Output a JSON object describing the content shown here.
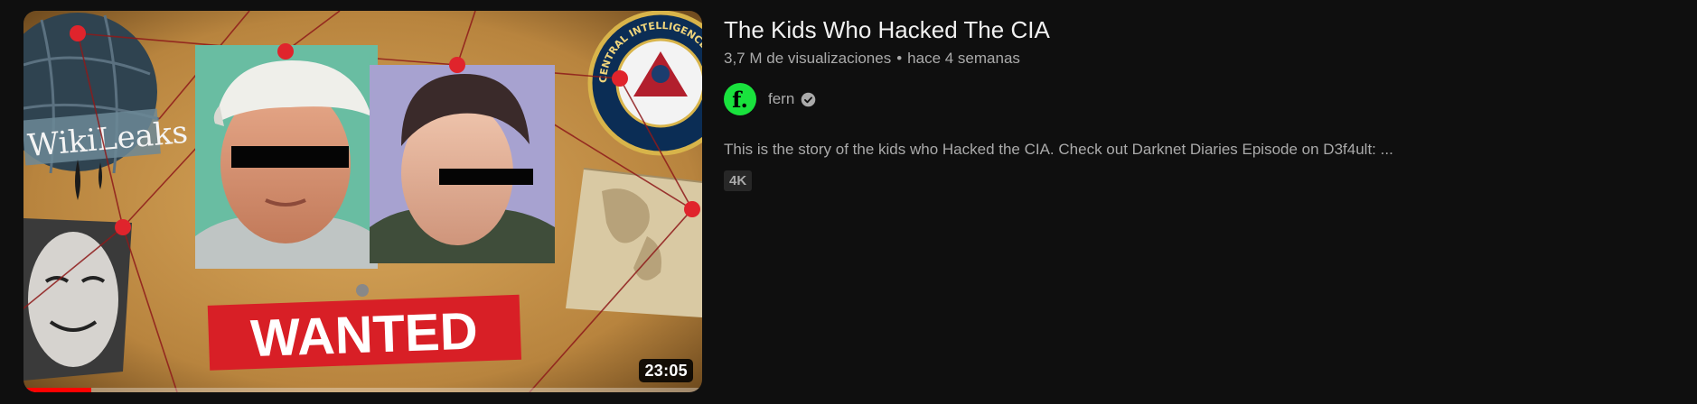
{
  "video": {
    "title": "The Kids Who Hacked The CIA",
    "views": "3,7 M de visualizaciones",
    "separator": "•",
    "age": "hace 4 semanas",
    "channel": {
      "name": "fern",
      "avatar_letter": "f.",
      "avatar_color": "#19e23d",
      "verified": true
    },
    "description": "This is the story of the kids who Hacked the CIA. Check out Darknet Diaries Episode on D3f4ult: ...",
    "badge": "4K",
    "duration": "23:05",
    "watch_progress": 0.1,
    "thumbnail": {
      "wanted_text": "WANTED",
      "wikileaks_text": "WikiLeaks",
      "cia_seal_text": "CENTRAL INTELLIGENCE AGENCY"
    }
  },
  "colors": {
    "background": "#0f0f0f",
    "title": "#f1f1f1",
    "secondary_text": "#aaaaaa",
    "progress": "#ff0000",
    "badge_bg": "#272727"
  }
}
